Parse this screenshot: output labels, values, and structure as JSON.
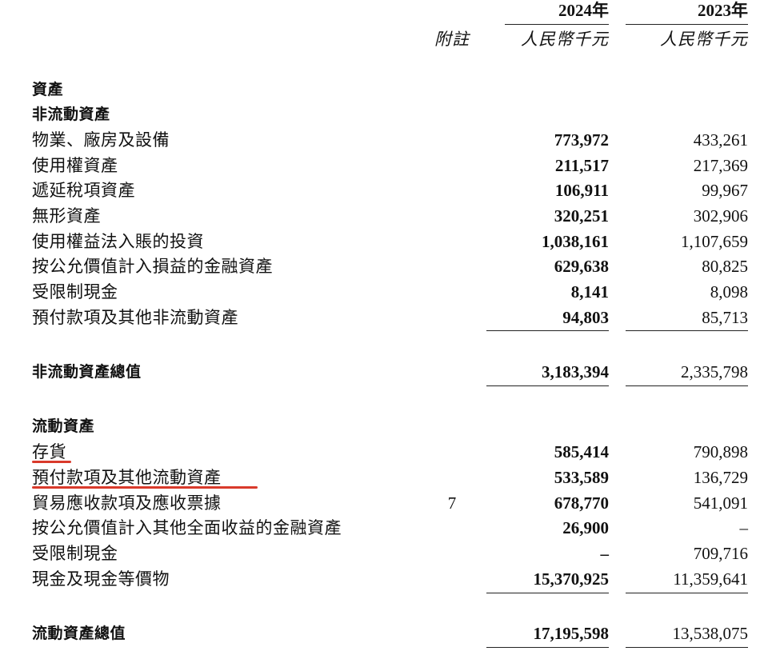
{
  "header": {
    "year_current": "2024年",
    "year_prior": "2023年",
    "note_label": "附註",
    "unit_current": "人民幣千元",
    "unit_prior": "人民幣千元"
  },
  "sections": {
    "assets_title": "資產",
    "non_current_title": "非流動資產",
    "current_title": "流動資產"
  },
  "non_current_items": [
    {
      "label": "物業、廠房及設備",
      "note": "",
      "y2024": "773,972",
      "y2023": "433,261"
    },
    {
      "label": "使用權資產",
      "note": "",
      "y2024": "211,517",
      "y2023": "217,369"
    },
    {
      "label": "遞延稅項資產",
      "note": "",
      "y2024": "106,911",
      "y2023": "99,967"
    },
    {
      "label": "無形資產",
      "note": "",
      "y2024": "320,251",
      "y2023": "302,906"
    },
    {
      "label": "使用權益法入賬的投資",
      "note": "",
      "y2024": "1,038,161",
      "y2023": "1,107,659"
    },
    {
      "label": "按公允價值計入損益的金融資產",
      "note": "",
      "y2024": "629,638",
      "y2023": "80,825"
    },
    {
      "label": "受限制現金",
      "note": "",
      "y2024": "8,141",
      "y2023": "8,098"
    },
    {
      "label": "預付款項及其他非流動資產",
      "note": "",
      "y2024": "94,803",
      "y2023": "85,713"
    }
  ],
  "non_current_total": {
    "label": "非流動資產總值",
    "y2024": "3,183,394",
    "y2023": "2,335,798"
  },
  "current_items": [
    {
      "label": "存貨",
      "note": "",
      "y2024": "585,414",
      "y2023": "790,898"
    },
    {
      "label": "預付款項及其他流動資產",
      "note": "",
      "y2024": "533,589",
      "y2023": "136,729"
    },
    {
      "label": "貿易應收款項及應收票據",
      "note": "7",
      "y2024": "678,770",
      "y2023": "541,091"
    },
    {
      "label": "按公允價值計入其他全面收益的金融資產",
      "note": "",
      "y2024": "26,900",
      "y2023": "–"
    },
    {
      "label": "受限制現金",
      "note": "",
      "y2024": "–",
      "y2023": "709,716"
    },
    {
      "label": "現金及現金等價物",
      "note": "",
      "y2024": "15,370,925",
      "y2023": "11,359,641"
    }
  ],
  "current_total": {
    "label": "流動資產總值",
    "y2024": "17,195,598",
    "y2023": "13,538,075"
  },
  "highlight_color": "#d93a2b"
}
